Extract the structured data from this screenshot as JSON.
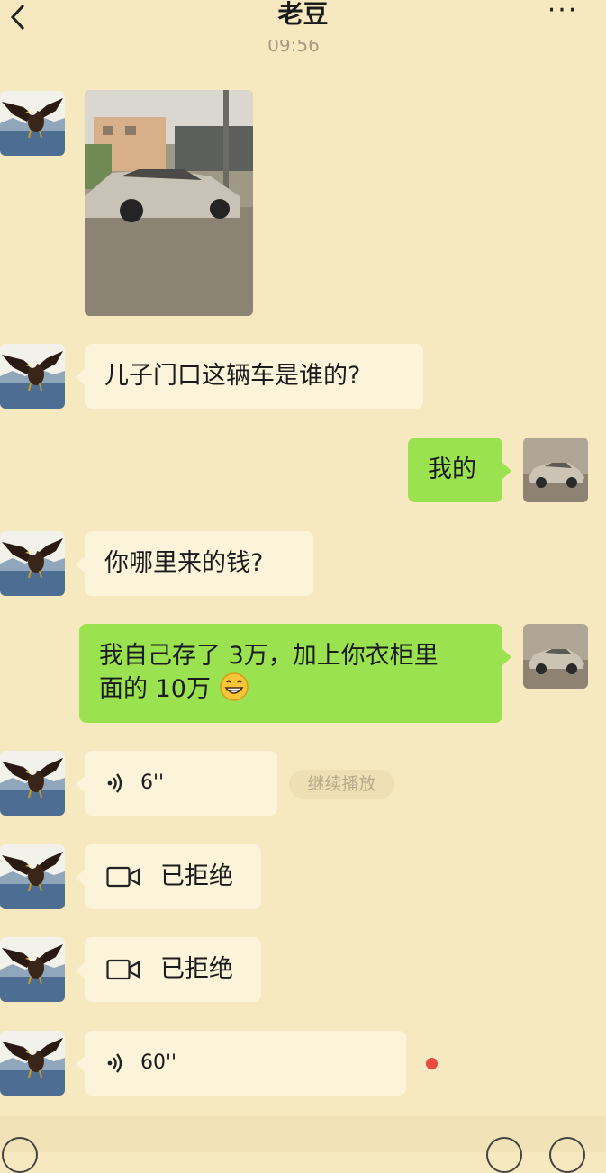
{
  "header": {
    "back_icon": "chevron-left-icon",
    "title": "老豆",
    "more_label": "···"
  },
  "timestamp": "09:56",
  "colors": {
    "background": "#f6e9bf",
    "incoming_bubble": "#fbf4da",
    "outgoing_bubble": "#9ae24f",
    "unread_dot": "#e84a44"
  },
  "messages": [
    {
      "sender": "contact",
      "type": "image",
      "image_subject": "car-photo"
    },
    {
      "sender": "contact",
      "type": "text",
      "text": "儿子门口这辆车是谁的?"
    },
    {
      "sender": "me",
      "type": "text",
      "text": "我的"
    },
    {
      "sender": "contact",
      "type": "text",
      "text": "你哪里来的钱?"
    },
    {
      "sender": "me",
      "type": "text",
      "line1": "我自己存了 3万，加上你衣柜里",
      "line2": "面的 10万",
      "emoji": "grinning-face-emoji"
    },
    {
      "sender": "contact",
      "type": "voice",
      "duration": "6''",
      "action": "继续播放"
    },
    {
      "sender": "contact",
      "type": "video-call",
      "status": "已拒绝"
    },
    {
      "sender": "contact",
      "type": "video-call",
      "status": "已拒绝"
    },
    {
      "sender": "contact",
      "type": "voice",
      "duration": "60''",
      "unread": true
    }
  ]
}
